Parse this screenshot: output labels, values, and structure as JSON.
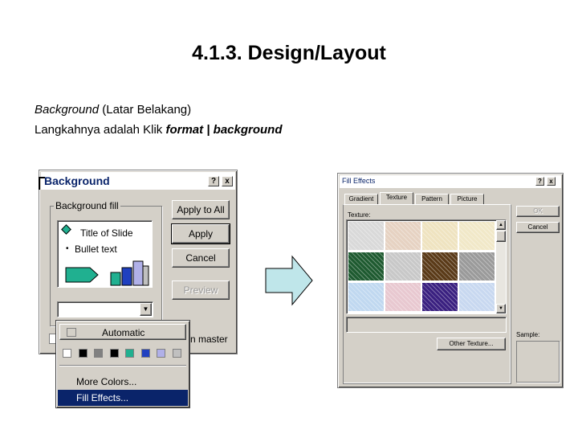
{
  "heading": "4.1.3. Design/Layout",
  "intro": {
    "term": "Background",
    "term_rest": " (Latar Belakang)",
    "steps_prefix": "Langkahnya adalah Klik ",
    "steps_bold": "format | background"
  },
  "bg_dialog": {
    "title": "Background",
    "help_btn": "?",
    "close_btn": "x",
    "group_label": "Background fill",
    "preview_title": "Title of Slide",
    "preview_bullet": "Bullet text",
    "apply_all": "Apply to All",
    "apply": "Apply",
    "cancel": "Cancel",
    "preview": "Preview",
    "omit_master_tail": "n master"
  },
  "dropdown": {
    "automatic": "Automatic",
    "swatch_colors": [
      "#ffffff",
      "#000000",
      "#808080",
      "#000000",
      "#20b090",
      "#2040c0",
      "#b0b0e8",
      "#c0c0c0"
    ],
    "more_colors": "More Colors...",
    "fill_effects": "Fill Effects..."
  },
  "fill_dialog": {
    "title": "Fill Effects",
    "tabs": [
      "Gradient",
      "Texture",
      "Pattern",
      "Picture"
    ],
    "texture_label": "Texture:",
    "ok": "OK",
    "cancel": "Cancel",
    "other_texture": "Other Texture...",
    "sample_label": "Sample:",
    "texture_colors": [
      "#d9d9d9",
      "#e6d2c2",
      "#efe3c0",
      "#f1e8c8",
      "#1e5a30",
      "#c8c8c8",
      "#5a3a18",
      "#9a9a9a",
      "#c0d8f0",
      "#e8c8d0",
      "#3a2080",
      "#c8d8f0"
    ]
  },
  "colors": {
    "title_bar": "#0a246a",
    "dialog_bg": "#d4d0c8",
    "arrow_fill": "#bfe6ea",
    "selection": "#0a246a"
  }
}
